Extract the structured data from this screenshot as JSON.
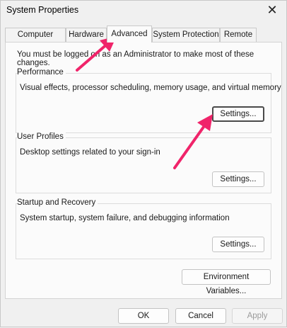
{
  "window": {
    "title": "System Properties"
  },
  "tabs": [
    {
      "label": "Computer Name"
    },
    {
      "label": "Hardware"
    },
    {
      "label": "Advanced"
    },
    {
      "label": "System Protection"
    },
    {
      "label": "Remote"
    }
  ],
  "notice": "You must be logged on as an Administrator to make most of these changes.",
  "groups": {
    "performance": {
      "label": "Performance",
      "desc": "Visual effects, processor scheduling, memory usage, and virtual memory",
      "button": "Settings..."
    },
    "profiles": {
      "label": "User Profiles",
      "desc": "Desktop settings related to your sign-in",
      "button": "Settings..."
    },
    "startup": {
      "label": "Startup and Recovery",
      "desc": "System startup, system failure, and debugging information",
      "button": "Settings..."
    }
  },
  "env_button": "Environment Variables...",
  "footer": {
    "ok": "OK",
    "cancel": "Cancel",
    "apply": "Apply"
  },
  "colors": {
    "annotation_arrow": "#f0246a"
  }
}
